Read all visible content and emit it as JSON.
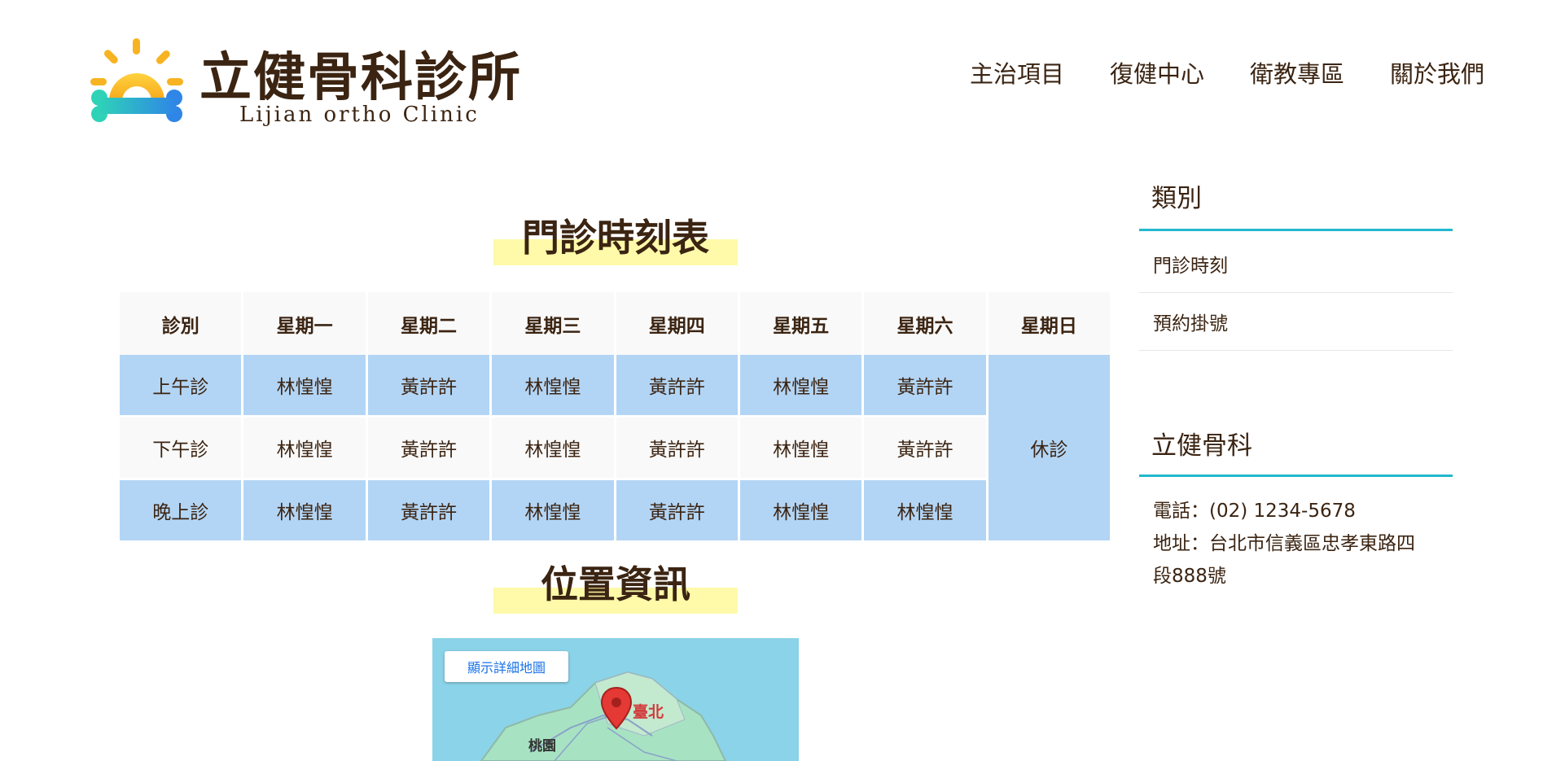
{
  "header": {
    "logo_title": "立健骨科診所",
    "logo_subtitle": "Lijian ortho Clinic",
    "nav": [
      "主治項目",
      "復健中心",
      "衛教專區",
      "關於我們"
    ]
  },
  "schedule": {
    "title": "門診時刻表",
    "headers": [
      "診別",
      "星期一",
      "星期二",
      "星期三",
      "星期四",
      "星期五",
      "星期六",
      "星期日"
    ],
    "rows": [
      {
        "label": "上午診",
        "cells": [
          "林惶惶",
          "黃許許",
          "林惶惶",
          "黃許許",
          "林惶惶",
          "黃許許"
        ]
      },
      {
        "label": "下午診",
        "cells": [
          "林惶惶",
          "黃許許",
          "林惶惶",
          "黃許許",
          "林惶惶",
          "黃許許"
        ]
      },
      {
        "label": "晚上診",
        "cells": [
          "林惶惶",
          "黃許許",
          "林惶惶",
          "黃許許",
          "林惶惶",
          "林惶惶"
        ]
      }
    ],
    "sunday": "休診"
  },
  "location": {
    "title": "位置資訊",
    "map_button": "顯示詳細地圖",
    "labels": {
      "taipei": "臺北",
      "taoyuan": "桃園"
    }
  },
  "sidebar": {
    "category_title": "類別",
    "categories": [
      "門診時刻",
      "預約掛號"
    ],
    "info_title": "立健骨科",
    "phone": "電話：(02) 1234-5678",
    "address_line1": "地址：台北市信義區忠孝東路四",
    "address_line2": "段888號"
  },
  "colors": {
    "text": "#3b2412",
    "accent_cyan": "#22b8cf",
    "highlight_yellow": "#fefaa9",
    "cell_blue": "#b3d5f5",
    "cell_grey": "#f9f9f9"
  }
}
